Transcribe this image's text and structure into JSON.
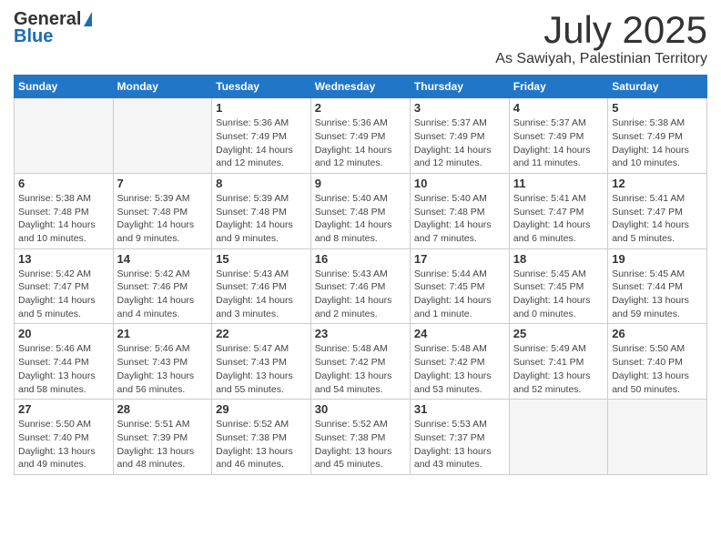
{
  "logo": {
    "line1": "General",
    "line2": "Blue"
  },
  "title": {
    "month_year": "July 2025",
    "location": "As Sawiyah, Palestinian Territory"
  },
  "calendar": {
    "headers": [
      "Sunday",
      "Monday",
      "Tuesday",
      "Wednesday",
      "Thursday",
      "Friday",
      "Saturday"
    ],
    "rows": [
      [
        {
          "day": "",
          "info": ""
        },
        {
          "day": "",
          "info": ""
        },
        {
          "day": "1",
          "info": "Sunrise: 5:36 AM\nSunset: 7:49 PM\nDaylight: 14 hours and 12 minutes."
        },
        {
          "day": "2",
          "info": "Sunrise: 5:36 AM\nSunset: 7:49 PM\nDaylight: 14 hours and 12 minutes."
        },
        {
          "day": "3",
          "info": "Sunrise: 5:37 AM\nSunset: 7:49 PM\nDaylight: 14 hours and 12 minutes."
        },
        {
          "day": "4",
          "info": "Sunrise: 5:37 AM\nSunset: 7:49 PM\nDaylight: 14 hours and 11 minutes."
        },
        {
          "day": "5",
          "info": "Sunrise: 5:38 AM\nSunset: 7:49 PM\nDaylight: 14 hours and 10 minutes."
        }
      ],
      [
        {
          "day": "6",
          "info": "Sunrise: 5:38 AM\nSunset: 7:48 PM\nDaylight: 14 hours and 10 minutes."
        },
        {
          "day": "7",
          "info": "Sunrise: 5:39 AM\nSunset: 7:48 PM\nDaylight: 14 hours and 9 minutes."
        },
        {
          "day": "8",
          "info": "Sunrise: 5:39 AM\nSunset: 7:48 PM\nDaylight: 14 hours and 9 minutes."
        },
        {
          "day": "9",
          "info": "Sunrise: 5:40 AM\nSunset: 7:48 PM\nDaylight: 14 hours and 8 minutes."
        },
        {
          "day": "10",
          "info": "Sunrise: 5:40 AM\nSunset: 7:48 PM\nDaylight: 14 hours and 7 minutes."
        },
        {
          "day": "11",
          "info": "Sunrise: 5:41 AM\nSunset: 7:47 PM\nDaylight: 14 hours and 6 minutes."
        },
        {
          "day": "12",
          "info": "Sunrise: 5:41 AM\nSunset: 7:47 PM\nDaylight: 14 hours and 5 minutes."
        }
      ],
      [
        {
          "day": "13",
          "info": "Sunrise: 5:42 AM\nSunset: 7:47 PM\nDaylight: 14 hours and 5 minutes."
        },
        {
          "day": "14",
          "info": "Sunrise: 5:42 AM\nSunset: 7:46 PM\nDaylight: 14 hours and 4 minutes."
        },
        {
          "day": "15",
          "info": "Sunrise: 5:43 AM\nSunset: 7:46 PM\nDaylight: 14 hours and 3 minutes."
        },
        {
          "day": "16",
          "info": "Sunrise: 5:43 AM\nSunset: 7:46 PM\nDaylight: 14 hours and 2 minutes."
        },
        {
          "day": "17",
          "info": "Sunrise: 5:44 AM\nSunset: 7:45 PM\nDaylight: 14 hours and 1 minute."
        },
        {
          "day": "18",
          "info": "Sunrise: 5:45 AM\nSunset: 7:45 PM\nDaylight: 14 hours and 0 minutes."
        },
        {
          "day": "19",
          "info": "Sunrise: 5:45 AM\nSunset: 7:44 PM\nDaylight: 13 hours and 59 minutes."
        }
      ],
      [
        {
          "day": "20",
          "info": "Sunrise: 5:46 AM\nSunset: 7:44 PM\nDaylight: 13 hours and 58 minutes."
        },
        {
          "day": "21",
          "info": "Sunrise: 5:46 AM\nSunset: 7:43 PM\nDaylight: 13 hours and 56 minutes."
        },
        {
          "day": "22",
          "info": "Sunrise: 5:47 AM\nSunset: 7:43 PM\nDaylight: 13 hours and 55 minutes."
        },
        {
          "day": "23",
          "info": "Sunrise: 5:48 AM\nSunset: 7:42 PM\nDaylight: 13 hours and 54 minutes."
        },
        {
          "day": "24",
          "info": "Sunrise: 5:48 AM\nSunset: 7:42 PM\nDaylight: 13 hours and 53 minutes."
        },
        {
          "day": "25",
          "info": "Sunrise: 5:49 AM\nSunset: 7:41 PM\nDaylight: 13 hours and 52 minutes."
        },
        {
          "day": "26",
          "info": "Sunrise: 5:50 AM\nSunset: 7:40 PM\nDaylight: 13 hours and 50 minutes."
        }
      ],
      [
        {
          "day": "27",
          "info": "Sunrise: 5:50 AM\nSunset: 7:40 PM\nDaylight: 13 hours and 49 minutes."
        },
        {
          "day": "28",
          "info": "Sunrise: 5:51 AM\nSunset: 7:39 PM\nDaylight: 13 hours and 48 minutes."
        },
        {
          "day": "29",
          "info": "Sunrise: 5:52 AM\nSunset: 7:38 PM\nDaylight: 13 hours and 46 minutes."
        },
        {
          "day": "30",
          "info": "Sunrise: 5:52 AM\nSunset: 7:38 PM\nDaylight: 13 hours and 45 minutes."
        },
        {
          "day": "31",
          "info": "Sunrise: 5:53 AM\nSunset: 7:37 PM\nDaylight: 13 hours and 43 minutes."
        },
        {
          "day": "",
          "info": ""
        },
        {
          "day": "",
          "info": ""
        }
      ]
    ]
  }
}
